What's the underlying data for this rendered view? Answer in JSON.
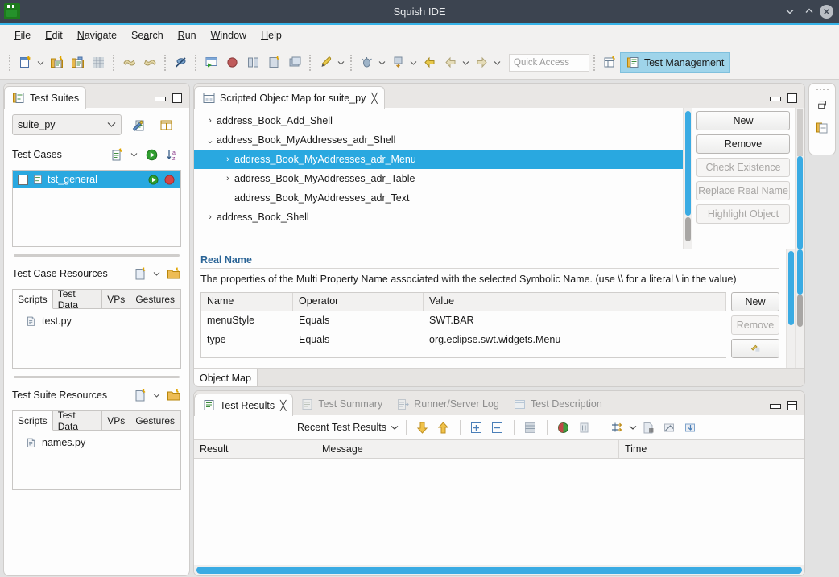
{
  "window": {
    "title": "Squish IDE",
    "minimize_label": "Minimize",
    "maximize_label": "Maximize",
    "close_label": "Close",
    "accent_color": "#36b3e8",
    "titlebar_color": "#3c4450"
  },
  "menubar": {
    "items": [
      {
        "label": "File",
        "mnemonic": "F"
      },
      {
        "label": "Edit",
        "mnemonic": "E"
      },
      {
        "label": "Navigate",
        "mnemonic": "N"
      },
      {
        "label": "Search",
        "mnemonic": "a"
      },
      {
        "label": "Run",
        "mnemonic": "R"
      },
      {
        "label": "Window",
        "mnemonic": "W"
      },
      {
        "label": "Help",
        "mnemonic": "H"
      }
    ]
  },
  "toolbar": {
    "quick_access_placeholder": "Quick Access",
    "perspective_label": "Test Management",
    "perspective_color": "#9fd4ea",
    "groups": [
      {
        "icons": [
          "new-file-icon",
          "new-file-dropdown",
          "new-test-suite-icon",
          "save-test-suite-icon",
          "grid-icon"
        ]
      },
      {
        "icons": [
          "undo-icon",
          "redo-icon"
        ]
      },
      {
        "icons": [
          "toggle-breakpoint-icon"
        ]
      },
      {
        "icons": [
          "record-window-icon",
          "record-icon",
          "compare-icon",
          "inspect-icon",
          "snapshot-icon"
        ]
      },
      {
        "icons": [
          "run-test-icon",
          "run-dropdown"
        ]
      },
      {
        "icons": [
          "debug-icon",
          "debug-dropdown",
          "step-icon",
          "step-dropdown",
          "back-arrow-icon",
          "prev-arrow-icon",
          "prev-dropdown",
          "next-arrow-icon",
          "next-dropdown"
        ]
      }
    ],
    "open_perspective_icon": "open-perspective-icon"
  },
  "test_suites": {
    "tab_label": "Test Suites",
    "tab_icon": "test-suites-icon",
    "suite_combo_value": "suite_py",
    "suite_tools": [
      "edit-suite-settings-icon",
      "suite-table-icon"
    ],
    "test_cases": {
      "title": "Test Cases",
      "tools": [
        "new-test-case-icon",
        "new-test-case-dropdown",
        "run-all-icon",
        "sort-az-icon"
      ],
      "rows": [
        {
          "name": "tst_general",
          "selected": true,
          "run_icon": "run-icon",
          "stop_icon": "stop-icon"
        }
      ]
    },
    "test_case_resources": {
      "title": "Test Case Resources",
      "tools": [
        "new-resource-icon",
        "new-resource-dropdown",
        "new-folder-icon"
      ],
      "tabs": [
        "Scripts",
        "Test Data",
        "VPs",
        "Gestures"
      ],
      "active_tab": "Scripts",
      "files": [
        {
          "name": "test.py",
          "icon": "python-file-icon"
        }
      ]
    },
    "test_suite_resources": {
      "title": "Test Suite Resources",
      "tools": [
        "new-resource-icon",
        "new-resource-dropdown",
        "new-folder-icon"
      ],
      "tabs": [
        "Scripts",
        "Test Data",
        "VPs",
        "Gestures"
      ],
      "active_tab": "Scripts",
      "files": [
        {
          "name": "names.py",
          "icon": "python-file-icon"
        }
      ]
    }
  },
  "editor": {
    "tab_label": "Scripted Object Map for suite_py",
    "tab_icon": "object-map-icon",
    "bottom_tab": "Object Map",
    "tree": [
      {
        "label": "address_Book_Add_Shell",
        "depth": 0,
        "twisty": "collapsed",
        "selected": false
      },
      {
        "label": "address_Book_MyAddresses_adr_Shell",
        "depth": 0,
        "twisty": "expanded",
        "selected": false
      },
      {
        "label": "address_Book_MyAddresses_adr_Menu",
        "depth": 1,
        "twisty": "collapsed",
        "selected": true
      },
      {
        "label": "address_Book_MyAddresses_adr_Table",
        "depth": 1,
        "twisty": "collapsed",
        "selected": false
      },
      {
        "label": "address_Book_MyAddresses_adr_Text",
        "depth": 1,
        "twisty": "none",
        "selected": false
      },
      {
        "label": "address_Book_Shell",
        "depth": 0,
        "twisty": "collapsed",
        "selected": false
      }
    ],
    "buttons": [
      {
        "label": "New",
        "enabled": true
      },
      {
        "label": "Remove",
        "enabled": true
      },
      {
        "label": "Check Existence",
        "enabled": false
      },
      {
        "label": "Replace Real Name",
        "enabled": false
      },
      {
        "label": "Highlight Object",
        "enabled": false
      }
    ],
    "real_name": {
      "title": "Real Name",
      "description": "The properties of the Multi Property Name associated with the selected Symbolic Name. (use \\\\ for a literal \\ in the value)",
      "columns": [
        "Name",
        "Operator",
        "Value"
      ],
      "rows": [
        {
          "name": "menuStyle",
          "operator": "Equals",
          "value": "SWT.BAR"
        },
        {
          "name": "type",
          "operator": "Equals",
          "value": "org.eclipse.swt.widgets.Menu"
        }
      ],
      "buttons": [
        {
          "label": "New",
          "enabled": true
        },
        {
          "label": "Remove",
          "enabled": false
        }
      ],
      "extra_button_icon": "properties-icon"
    }
  },
  "results": {
    "tabs": [
      {
        "label": "Test Results",
        "icon": "test-results-icon",
        "active": true,
        "closable": true
      },
      {
        "label": "Test Summary",
        "icon": "test-summary-icon",
        "active": false,
        "closable": false
      },
      {
        "label": "Runner/Server Log",
        "icon": "runner-log-icon",
        "active": false,
        "closable": false
      },
      {
        "label": "Test Description",
        "icon": "test-description-icon",
        "active": false,
        "closable": false
      }
    ],
    "toolbar": {
      "dropdown_label": "Recent Test Results",
      "icons": [
        "next-failure-icon",
        "previous-failure-icon",
        "expand-all-icon",
        "collapse-all-icon",
        "filter-icon",
        "pass-fail-icon",
        "clear-results-icon",
        "view-menu-icon",
        "view-menu-dropdown",
        "export-icon",
        "import-icon",
        "save-report-icon"
      ]
    },
    "columns": [
      "Result",
      "Message",
      "Time"
    ],
    "rows": []
  },
  "edge_bar": {
    "icons": [
      "restore-icon",
      "test-suites-minimized-icon"
    ]
  }
}
